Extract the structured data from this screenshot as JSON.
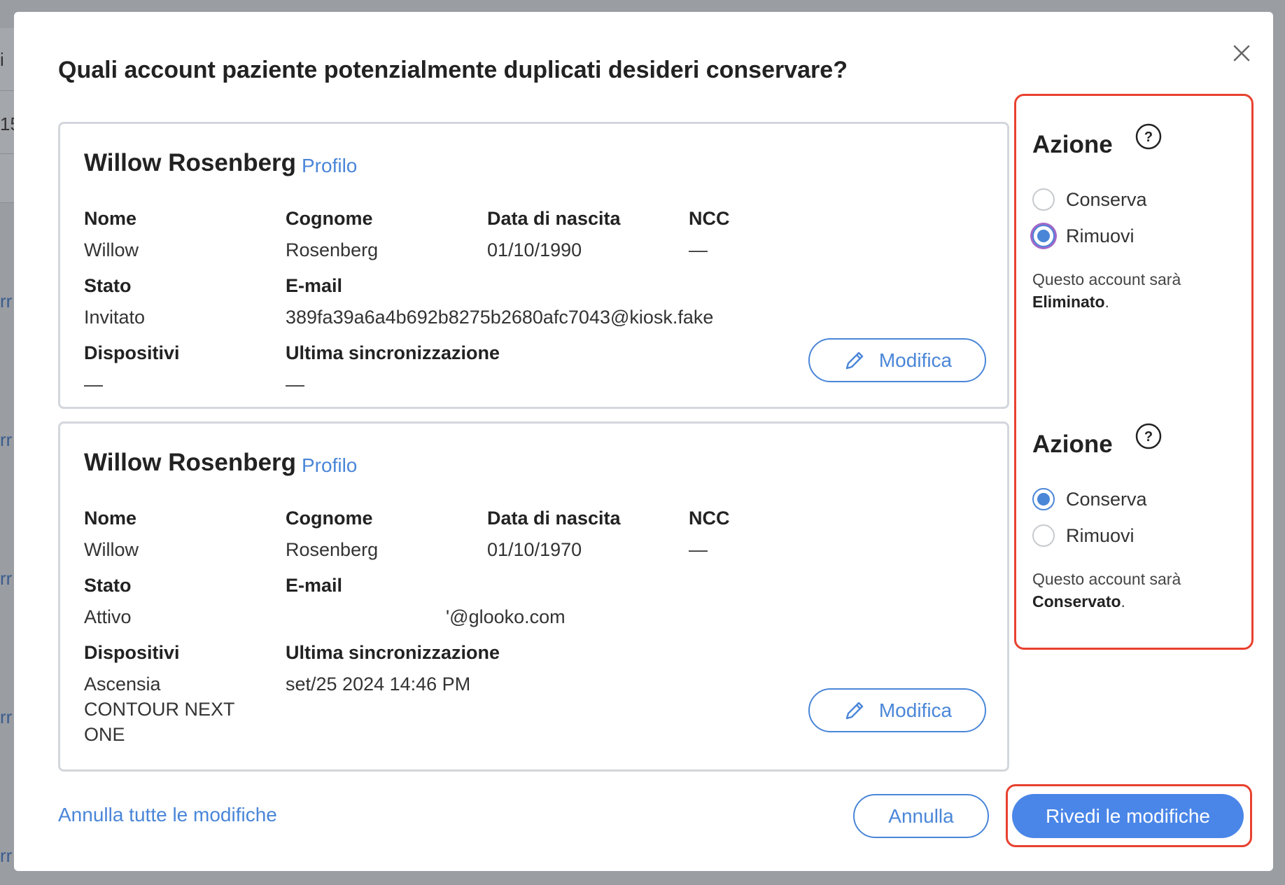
{
  "background": {
    "fragments": [
      "i",
      "15",
      "rr",
      "rr",
      "rr",
      "rr",
      "rr"
    ]
  },
  "modal": {
    "title": "Quali account paziente potenzialmente duplicati desideri conservare?",
    "close_icon": "close-icon"
  },
  "labels": {
    "first_name": "Nome",
    "last_name": "Cognome",
    "birth_date": "Data di nascita",
    "ncc": "NCC",
    "status": "Stato",
    "email": "E-mail",
    "devices": "Dispositivi",
    "last_sync": "Ultima sincronizzazione",
    "profile": "Profilo",
    "edit": "Modifica"
  },
  "accounts": [
    {
      "name": "Willow Rosenberg",
      "first_name": "Willow",
      "last_name": "Rosenberg",
      "birth_date": "01/10/1990",
      "ncc": "—",
      "status": "Invitato",
      "email": "389fa39a6a4b692b8275b2680afc7043@kiosk.fake",
      "devices": "—",
      "last_sync": "—",
      "action": {
        "title": "Azione",
        "options": [
          "Conserva",
          "Rimuovi"
        ],
        "selected": "Rimuovi",
        "note_prefix": "Questo account sarà",
        "note_result": "Eliminato",
        "note_suffix": "."
      }
    },
    {
      "name": "Willow Rosenberg",
      "first_name": "Willow",
      "last_name": "Rosenberg",
      "birth_date": "01/10/1970",
      "ncc": "—",
      "status": "Attivo",
      "email": "'@glooko.com",
      "devices_line1": "Ascensia",
      "devices_line2": "CONTOUR NEXT",
      "devices_line3": "ONE",
      "last_sync": "set/25 2024 14:46 PM",
      "action": {
        "title": "Azione",
        "options": [
          "Conserva",
          "Rimuovi"
        ],
        "selected": "Conserva",
        "note_prefix": "Questo account sarà",
        "note_result": "Conservato",
        "note_suffix": "."
      }
    }
  ],
  "footer": {
    "undo_all": "Annulla tutte le modifiche",
    "cancel": "Annulla",
    "review": "Rivedi le modifiche"
  },
  "colors": {
    "accent": "#4a86d8",
    "highlight": "#e8412f"
  }
}
